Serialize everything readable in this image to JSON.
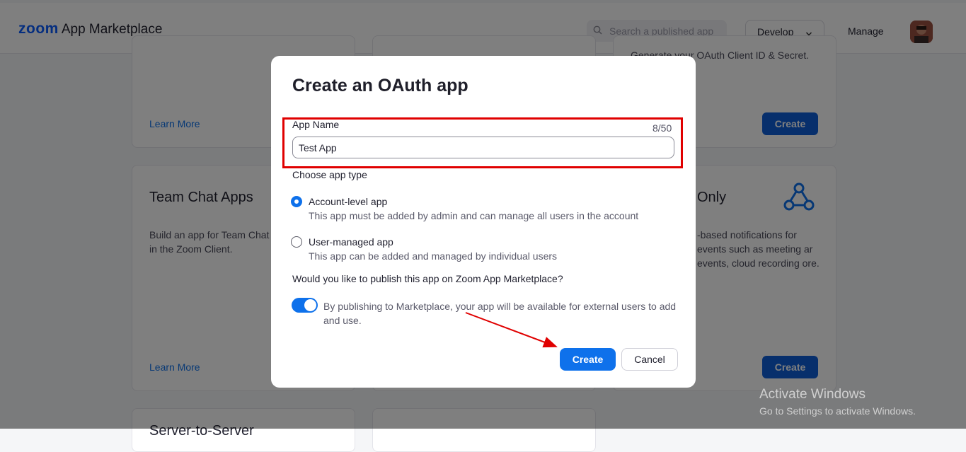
{
  "header": {
    "logo_zoom": "zoom",
    "logo_text": "App Marketplace",
    "search_placeholder": "Search a published app",
    "develop_label": "Develop",
    "manage_label": "Manage"
  },
  "background_cards": {
    "top_left": {
      "learn_more": "Learn More"
    },
    "top_right": {
      "desc_fragment": "Generate your OAuth Client ID & Secret.",
      "create": "Create"
    },
    "team_chat": {
      "title": "Team Chat Apps",
      "desc": "Build an app for Team Chat that can be added in the Zoom Client.",
      "learn_more": "Learn More"
    },
    "webhook_only": {
      "title": "Only",
      "desc": "-based notifications for events such as meeting ar events, cloud recording ore.",
      "create": "Create"
    },
    "server_to_server": {
      "title": "Server-to-Server"
    }
  },
  "watermark": {
    "line1": "Activate Windows",
    "line2": "Go to Settings to activate Windows."
  },
  "modal": {
    "title": "Create an OAuth app",
    "app_name_label": "App Name",
    "app_name_counter": "8/50",
    "app_name_value": "Test App",
    "choose_type_label": "Choose app type",
    "options": [
      {
        "label": "Account-level app",
        "desc": "This app must be added by admin and can manage all users in the account",
        "selected": true
      },
      {
        "label": "User-managed app",
        "desc": "This app can be added and managed by individual users",
        "selected": false
      }
    ],
    "publish_question": "Would you like to publish this app on Zoom App Marketplace?",
    "publish_enabled": true,
    "publish_desc": "By publishing to Marketplace, your app will be available for external users to add and use.",
    "create_label": "Create",
    "cancel_label": "Cancel"
  },
  "colors": {
    "accent": "#0e71eb",
    "highlight": "#e00000",
    "overlay": "rgba(0,0,0,0.5)"
  }
}
